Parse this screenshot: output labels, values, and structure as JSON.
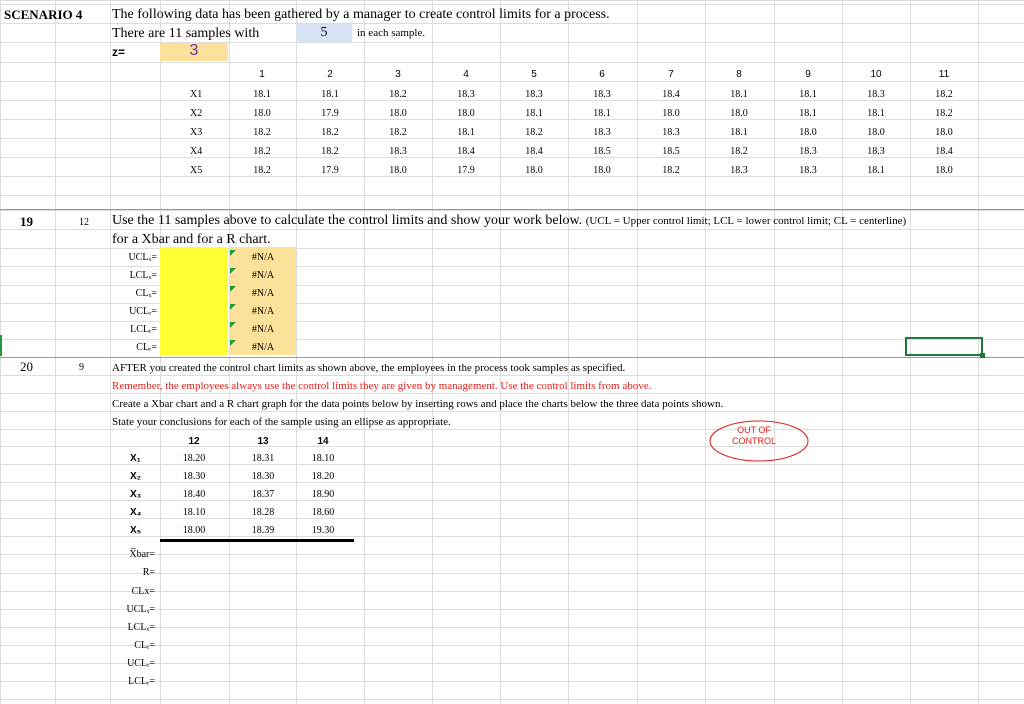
{
  "scenario": {
    "label": "SCENARIO 4",
    "title": "The following data has been gathered by a manager to create control limits for a process.",
    "samples_text": "There are 11 samples with",
    "sample_size": "5",
    "sample_size_suffix": "in each sample.",
    "z_label": "z=",
    "z_value": "3"
  },
  "data_table": {
    "columns": [
      "1",
      "2",
      "3",
      "4",
      "5",
      "6",
      "7",
      "8",
      "9",
      "10",
      "11"
    ],
    "rows": [
      {
        "label": "X1",
        "values": [
          "18.1",
          "18.1",
          "18.2",
          "18.3",
          "18.3",
          "18.3",
          "18.4",
          "18.1",
          "18.1",
          "18.3",
          "18.2"
        ]
      },
      {
        "label": "X2",
        "values": [
          "18.0",
          "17.9",
          "18.0",
          "18.0",
          "18.1",
          "18.1",
          "18.0",
          "18.0",
          "18.1",
          "18.1",
          "18.2"
        ]
      },
      {
        "label": "X3",
        "values": [
          "18.2",
          "18.2",
          "18.2",
          "18.1",
          "18.2",
          "18.3",
          "18.3",
          "18.1",
          "18.0",
          "18.0",
          "18.0"
        ]
      },
      {
        "label": "X4",
        "values": [
          "18.2",
          "18.2",
          "18.3",
          "18.4",
          "18.4",
          "18.5",
          "18.5",
          "18.2",
          "18.3",
          "18.3",
          "18.4"
        ]
      },
      {
        "label": "X5",
        "values": [
          "18.2",
          "17.9",
          "18.0",
          "17.9",
          "18.0",
          "18.0",
          "18.2",
          "18.3",
          "18.3",
          "18.1",
          "18.0"
        ]
      }
    ]
  },
  "q19": {
    "number": "19",
    "points": "12",
    "text": "Use the 11 samples above to calculate the control limits and show your work below.",
    "note": "(UCL = Upper control limit; LCL = lower control limit; CL = centerline)",
    "text2": "for a Xbar and for a R chart.",
    "limits": [
      {
        "label": "UCLₓ=",
        "value": "#N/A"
      },
      {
        "label": "LCLₓ=",
        "value": "#N/A"
      },
      {
        "label": "CLₓ=",
        "value": "#N/A"
      },
      {
        "label": "UCLᵣ=",
        "value": "#N/A"
      },
      {
        "label": "LCLᵣ=",
        "value": "#N/A"
      },
      {
        "label": "CLᵣ=",
        "value": "#N/A"
      }
    ]
  },
  "q20": {
    "number": "20",
    "points": "9",
    "line1": "AFTER you created the control chart limits as shown above, the employees in the process took samples as specified.",
    "line2": "Remember, the employees always use the control limits they are given by management. Use the control limits from above.",
    "line3": "Create a Xbar chart and a R chart graph for the data points below by  inserting rows and place the charts below the three data points shown.",
    "line4": "State your conclusions for each of the sample using an ellipse as appropriate.",
    "out_of_control_line1": "OUT OF",
    "out_of_control_line2": "CONTROL",
    "columns": [
      "12",
      "13",
      "14"
    ],
    "rows": [
      {
        "label": "X₁",
        "values": [
          "18.20",
          "18.31",
          "18.10"
        ]
      },
      {
        "label": "X₂",
        "values": [
          "18.30",
          "18.30",
          "18.20"
        ]
      },
      {
        "label": "X₃",
        "values": [
          "18.40",
          "18.37",
          "18.90"
        ]
      },
      {
        "label": "X₄",
        "values": [
          "18.10",
          "18.28",
          "18.60"
        ]
      },
      {
        "label": "X₅",
        "values": [
          "18.00",
          "18.39",
          "19.30"
        ]
      }
    ],
    "summary_labels": [
      "X̅bar=",
      "R=",
      "CLx=",
      "UCLₓ=",
      "LCLₓ=",
      "CLᵣ=",
      "UCLᵣ=",
      "LCLᵣ="
    ]
  },
  "colors": {
    "red": "#e0201b",
    "yellow": "#ffff33",
    "orange": "#fde19a",
    "blue_cell": "#d6e3f3",
    "purple": "#7030a0",
    "green": "#1e9a3a"
  }
}
